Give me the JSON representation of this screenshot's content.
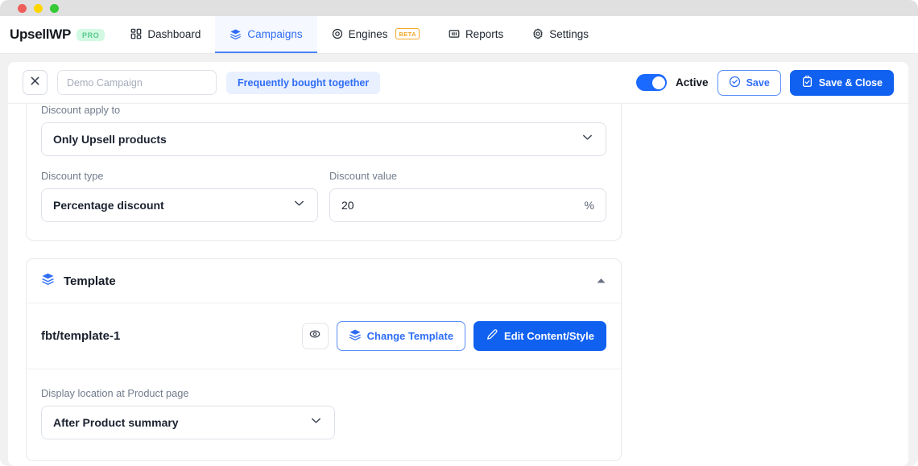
{
  "window": {
    "traffic_lights": [
      "close",
      "minimize",
      "maximize"
    ]
  },
  "nav": {
    "brand": "UpsellWP",
    "brand_badge": "PRO",
    "items": [
      {
        "label": "Dashboard",
        "icon": "grid-icon",
        "active": false,
        "badge": null
      },
      {
        "label": "Campaigns",
        "icon": "layers-icon",
        "active": true,
        "badge": null
      },
      {
        "label": "Engines",
        "icon": "target-icon",
        "active": false,
        "badge": "BETA"
      },
      {
        "label": "Reports",
        "icon": "bar-chart-icon",
        "active": false,
        "badge": null
      },
      {
        "label": "Settings",
        "icon": "gear-icon",
        "active": false,
        "badge": null
      }
    ]
  },
  "toolbar": {
    "close_icon": "close-icon",
    "campaign_name_value": "",
    "campaign_name_placeholder": "Demo Campaign",
    "engine_pill": "Frequently bought together",
    "toggle_state_label": "Active",
    "toggle_on": true,
    "save_label": "Save",
    "save_close_label": "Save & Close"
  },
  "discount": {
    "apply_to_label": "Discount apply to",
    "apply_to_value": "Only Upsell products",
    "type_label": "Discount type",
    "type_value": "Percentage discount",
    "value_label": "Discount value",
    "value_amount": "20",
    "value_suffix": "%"
  },
  "template": {
    "section_title": "Template",
    "collapsed": false,
    "name": "fbt/template-1",
    "preview_icon": "eye-icon",
    "change_label": "Change Template",
    "edit_label": "Edit Content/Style",
    "location_label": "Display location at Product page",
    "location_value": "After Product summary"
  },
  "colors": {
    "accent": "#1161f0",
    "accent_light": "#2f6df6",
    "pill_bg": "#e9f0ff",
    "pro_badge_bg": "#d2f9e2",
    "pro_badge_fg": "#57c98a",
    "beta_badge": "#f5a623",
    "page_bg": "#f1f1f2"
  }
}
